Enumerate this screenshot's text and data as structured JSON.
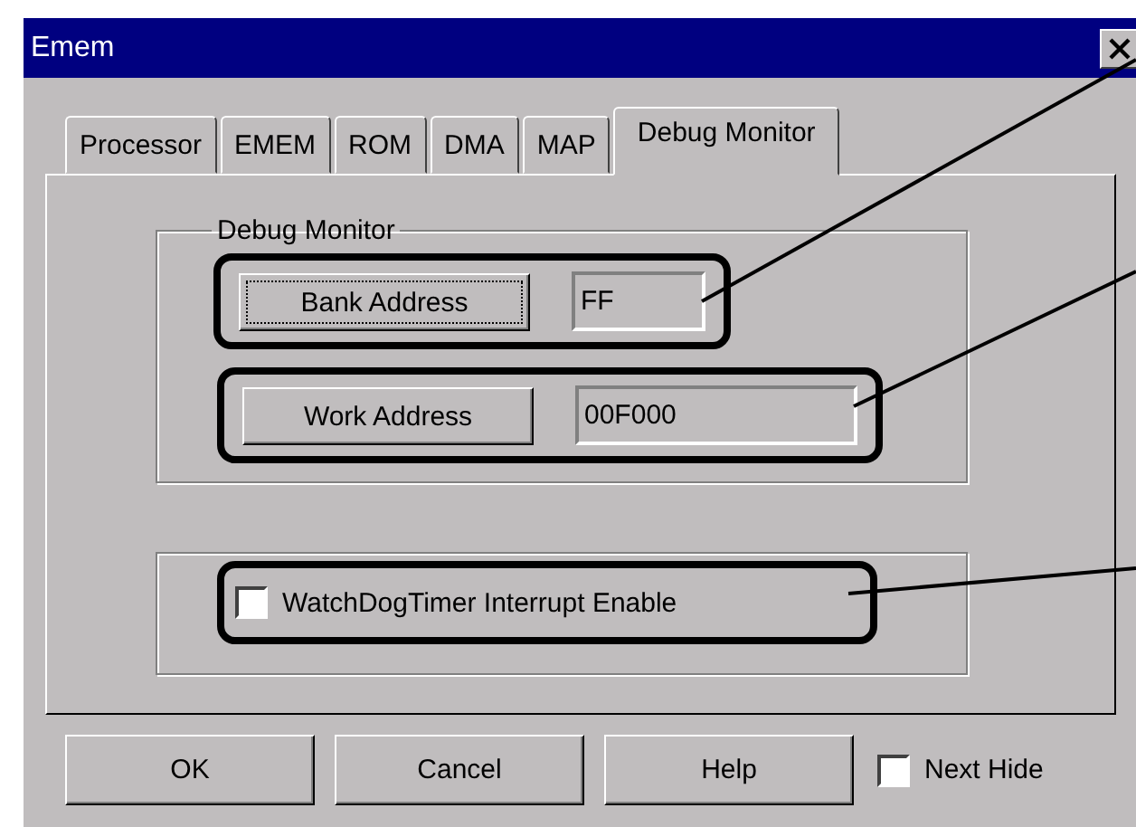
{
  "window": {
    "title": "Emem"
  },
  "tabs": [
    {
      "label": "Processor",
      "selected": false
    },
    {
      "label": "EMEM",
      "selected": false
    },
    {
      "label": "ROM",
      "selected": false
    },
    {
      "label": "DMA",
      "selected": false
    },
    {
      "label": "MAP",
      "selected": false
    },
    {
      "label": "Debug Monitor",
      "selected": true
    }
  ],
  "group": {
    "title": "Debug Monitor",
    "rows": [
      {
        "button": "Bank Address",
        "focused": true,
        "value": "FF",
        "highlighted": true
      },
      {
        "button": "Work Address",
        "focused": false,
        "value": "00F000",
        "highlighted": true
      }
    ]
  },
  "watchdog": {
    "label": "WatchDogTimer Interrupt Enable",
    "checked": false,
    "highlighted": true
  },
  "buttons": [
    "OK",
    "Cancel",
    "Help"
  ],
  "next_hide": {
    "label": "Next Hide",
    "checked": false
  }
}
